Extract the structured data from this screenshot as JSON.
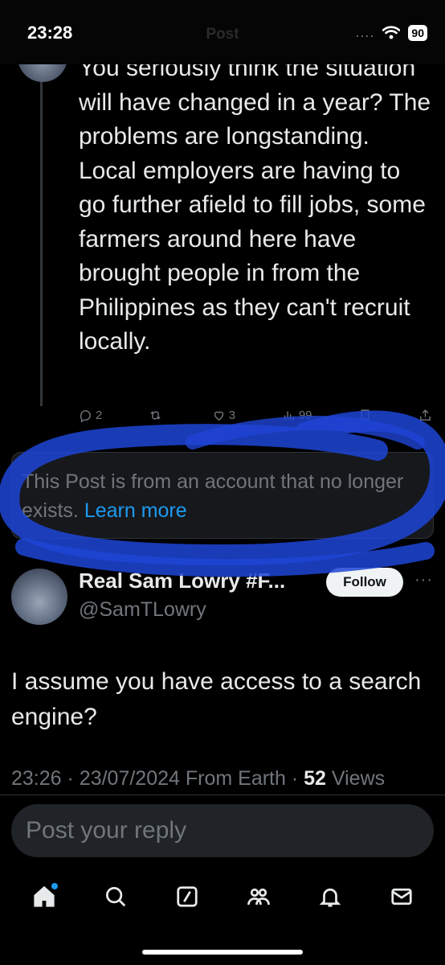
{
  "status_bar": {
    "time": "23:28",
    "battery": "90",
    "signal": "....",
    "nav_title_ghost": "Post"
  },
  "previous_post": {
    "text": "You seriously think the situation will have changed in a year? The problems are longstanding. Local employers are having to go further afield to fill jobs, some farmers around here have brought people in from the Philippines as they can't recruit locally.",
    "actions": {
      "replies": "2",
      "reposts": "",
      "likes": "3",
      "views": "99"
    }
  },
  "unavailable_notice": {
    "text": "This Post is from an account that no longer exists.",
    "link": "Learn more"
  },
  "main_post": {
    "author_name": "Real Sam Lowry #F...",
    "author_handle": "@SamTLowry",
    "follow_label": "Follow",
    "more": "···",
    "text": "I assume you have access to a search engine?",
    "time": "23:26",
    "date": "23/07/2024",
    "source": "From Earth",
    "sep": "·",
    "views_count": "52",
    "views_label": "Views"
  },
  "reply": {
    "placeholder": "Post your reply"
  },
  "bottom_nav": [
    "home-icon",
    "search-icon",
    "grok-icon",
    "communities-icon",
    "notifications-icon",
    "messages-icon"
  ],
  "colors": {
    "accent": "#1d9bf0",
    "highlight_scribble": "#1f45d6",
    "background": "#000000"
  }
}
